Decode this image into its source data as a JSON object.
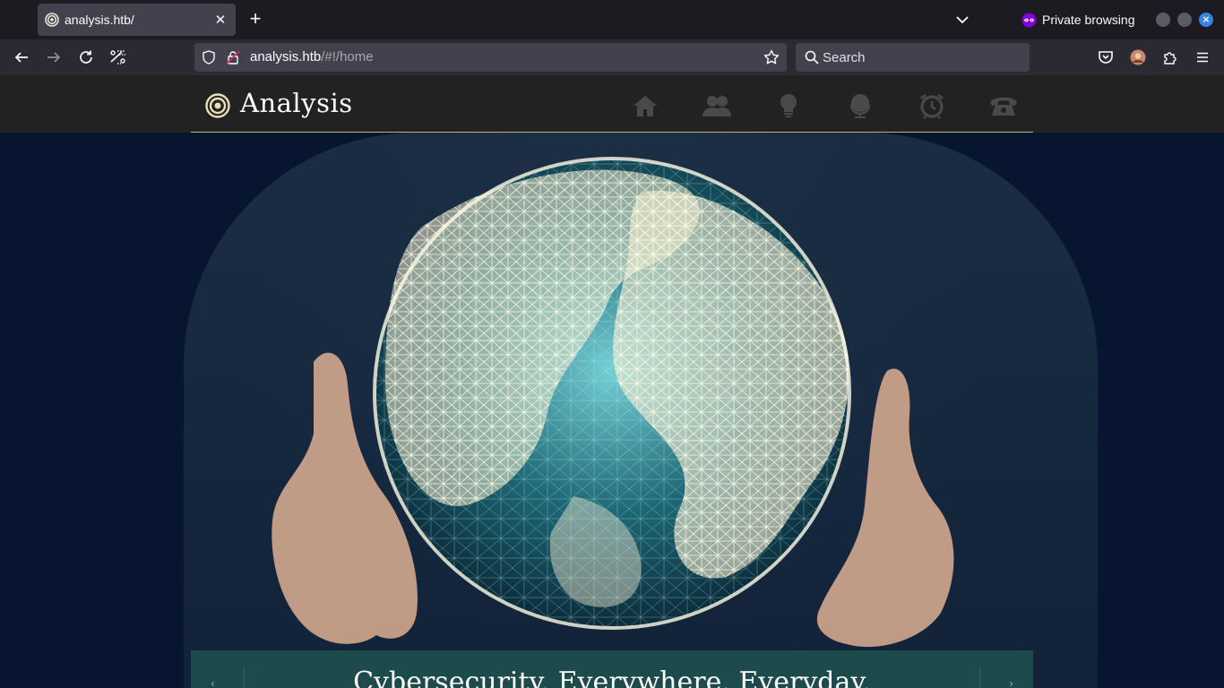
{
  "browser": {
    "tab": {
      "title": "analysis.htb/"
    },
    "new_tab_label": "+",
    "private_label": "Private browsing",
    "url": {
      "host": "analysis.htb",
      "path": "/#!/home"
    },
    "search": {
      "placeholder": "Search"
    }
  },
  "site": {
    "logo_text": "Analysis",
    "nav": [
      "home-icon",
      "users-icon",
      "lightbulb-icon",
      "globe-icon",
      "alarm-clock-icon",
      "phone-icon"
    ],
    "hero_caption": "Cybersecurity. Everywhere. Everyday."
  },
  "colors": {
    "header_bg": "#222222",
    "header_rule": "#b5bb6a",
    "caption_bg": "#1d4a4a",
    "nav_icon": "#4a4a4a",
    "accent_private": "#8000d7"
  }
}
